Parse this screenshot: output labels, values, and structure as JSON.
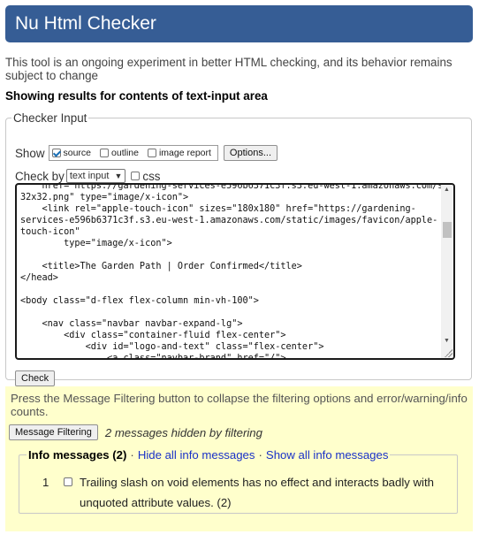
{
  "header": {
    "title": "Nu Html Checker"
  },
  "intro": "This tool is an ongoing experiment in better HTML checking, and its behavior remains subject to change",
  "showing": "Showing results for contents of text-input area",
  "checker_input": {
    "legend": "Checker Input",
    "show_label": "Show",
    "options": [
      {
        "label": "source",
        "checked": true
      },
      {
        "label": "outline",
        "checked": false
      },
      {
        "label": "image report",
        "checked": false
      }
    ],
    "options_button": "Options...",
    "check_by_label": "Check by",
    "check_by_value": "text input",
    "css_label": "css",
    "source_code": "    href=\"https://gardening-services-e596b6371c3f.s3.eu-west-1.amazonaws.com/static/images/favicon/favicon-\n32x32.png\" type=\"image/x-icon\">\n    <link rel=\"apple-touch-icon\" sizes=\"180x180\" href=\"https://gardening-\nservices-e596b6371c3f.s3.eu-west-1.amazonaws.com/static/images/favicon/apple-\ntouch-icon\"\n        type=\"image/x-icon\">\n\n    <title>The Garden Path | Order Confirmed</title>\n</head>\n\n<body class=\"d-flex flex-column min-vh-100\">\n\n    <nav class=\"navbar navbar-expand-lg\">\n        <div class=\"container-fluid flex-center\">\n            <div id=\"logo-and-text\" class=\"flex-center\">\n                <a class=\"navbar-brand\" href=\"/\">",
    "check_button": "Check"
  },
  "results": {
    "filter_note": "Press the Message Filtering button to collapse the filtering options and error/warning/info counts.",
    "filter_button": "Message Filtering",
    "hidden_note": "2 messages hidden by filtering",
    "info_title": "Info messages (2)",
    "sep": "·",
    "hide_all": "Hide all info messages",
    "show_all": "Show all info messages",
    "messages": [
      {
        "num": "1",
        "text": "Trailing slash on void elements has no effect and interacts badly with unquoted attribute values. (2)"
      }
    ]
  }
}
